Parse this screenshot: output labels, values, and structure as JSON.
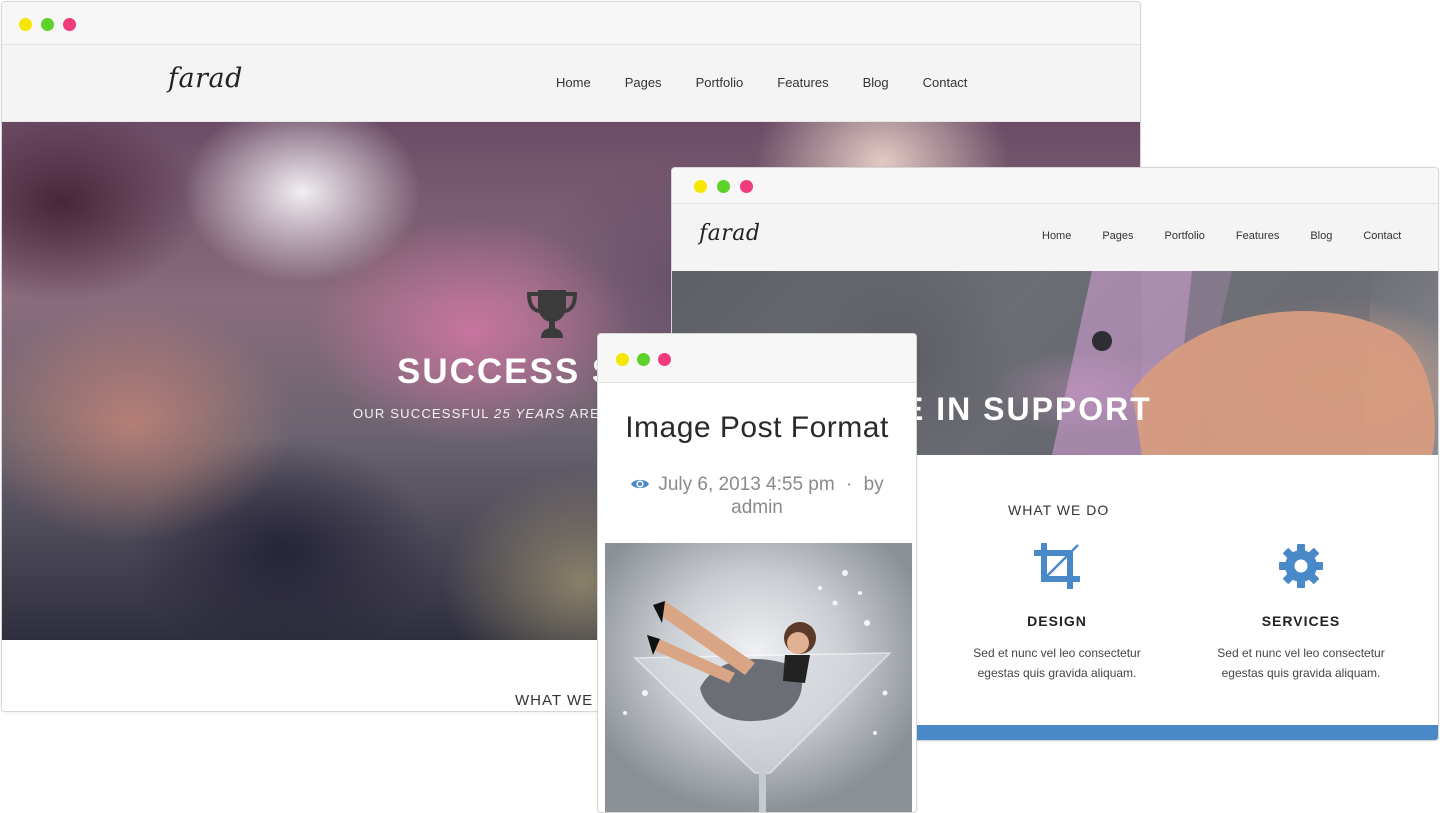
{
  "window_back": {
    "logo": "farad",
    "nav": [
      "Home",
      "Pages",
      "Portfolio",
      "Features",
      "Blog",
      "Contact"
    ],
    "hero": {
      "title": "SUCCESS S",
      "subtitle_pre": "OUR SUCCESSFUL ",
      "subtitle_em": "25 YEARS",
      "subtitle_post": " ARE BASI"
    },
    "section_heading": "WHAT WE"
  },
  "window_middle": {
    "logo": "farad",
    "nav": [
      "Home",
      "Pages",
      "Portfolio",
      "Features",
      "Blog",
      "Contact"
    ],
    "hero_title": "E IN SUPPORT",
    "section_heading": "WHAT WE DO",
    "features": [
      {
        "icon": "crop-icon",
        "title": "DESIGN",
        "text": "Sed et nunc vel leo consectetur egestas quis gravida aliquam."
      },
      {
        "icon": "gear-icon",
        "title": "SERVICES",
        "text": "Sed et nunc vel leo consectetur egestas quis gravida aliquam."
      }
    ]
  },
  "window_front": {
    "post_title": "Image Post Format",
    "date": "July 6, 2013 4:55 pm",
    "separator": "·",
    "by_label": "by",
    "author": "admin"
  },
  "colors": {
    "dot_yellow": "#f6e600",
    "dot_green": "#5cd22a",
    "dot_pink": "#f03c7d",
    "accent_blue": "#4a89c8",
    "nav_bg": "#f4f4f4"
  }
}
